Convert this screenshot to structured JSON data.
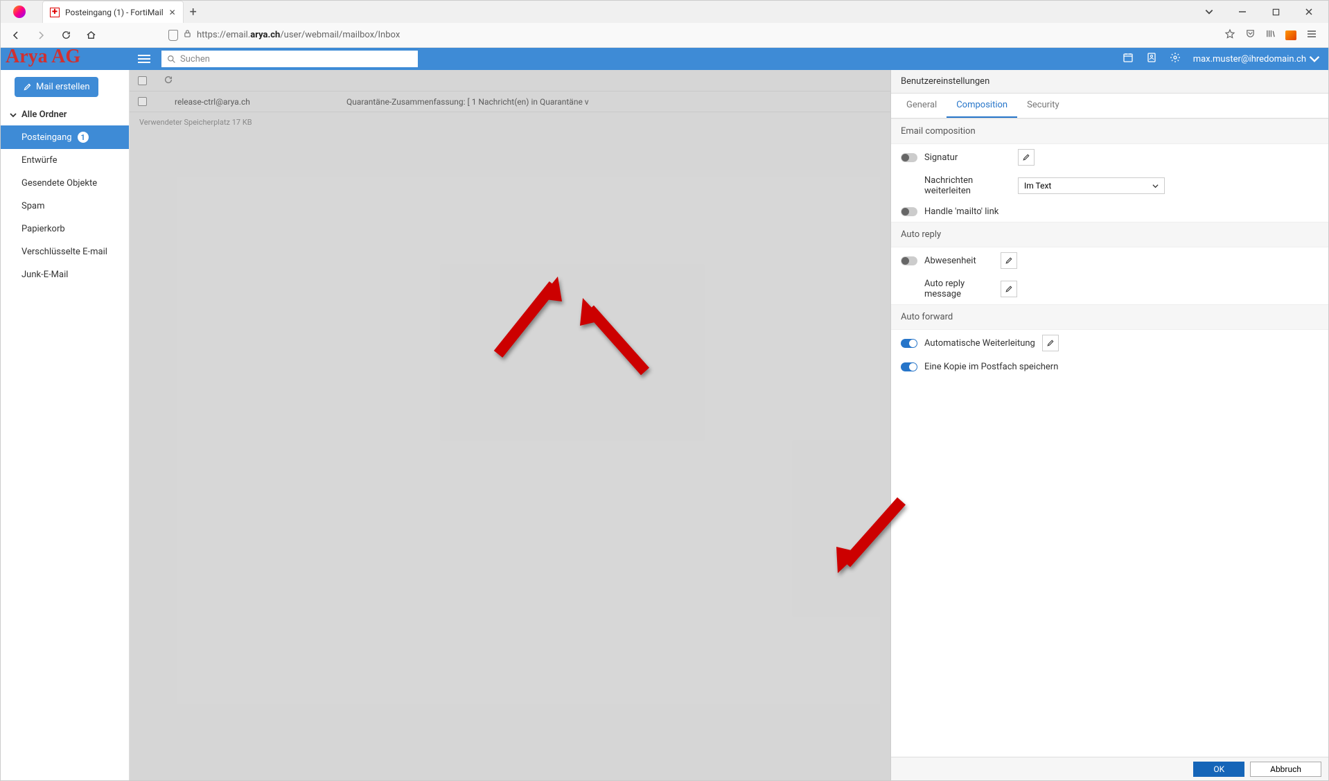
{
  "browser": {
    "tab_title": "Posteingang (1) - FortiMail",
    "url_prefix": "https://email.",
    "url_bold": "arya.ch",
    "url_suffix": "/user/webmail/mailbox/Inbox"
  },
  "app": {
    "logo": "Arya AG",
    "search_placeholder": "Suchen",
    "user_email": "max.muster@ihredomain.ch"
  },
  "sidebar": {
    "compose_label": "Mail erstellen",
    "all_folders": "Alle Ordner",
    "folders": {
      "inbox": "Posteingang",
      "inbox_badge": "1",
      "drafts": "Entwürfe",
      "sent": "Gesendete Objekte",
      "spam": "Spam",
      "trash": "Papierkorb",
      "encrypted": "Verschlüsselte E-mail",
      "junk": "Junk-E-Mail"
    }
  },
  "mail": {
    "row_from": "release-ctrl@arya.ch",
    "row_subject": "Quarantäne-Zusammenfassung: [ 1 Nachricht(en) in Quarantäne v",
    "storage": "Verwendeter Speicherplatz 17 KB"
  },
  "settings": {
    "title": "Benutzereinstellungen",
    "tabs": {
      "general": "General",
      "composition": "Composition",
      "security": "Security"
    },
    "sections": {
      "email_composition": "Email composition",
      "auto_reply": "Auto reply",
      "auto_forward": "Auto forward"
    },
    "labels": {
      "signature": "Signatur",
      "forward_mode": "Nachrichten weiterleiten",
      "forward_mode_value": "Im Text",
      "mailto": "Handle 'mailto' link",
      "away": "Abwesenheit",
      "auto_reply_message": "Auto reply message",
      "auto_forward": "Automatische Weiterleitung",
      "keep_copy": "Eine Kopie im Postfach speichern"
    },
    "buttons": {
      "ok": "OK",
      "cancel": "Abbruch"
    }
  }
}
